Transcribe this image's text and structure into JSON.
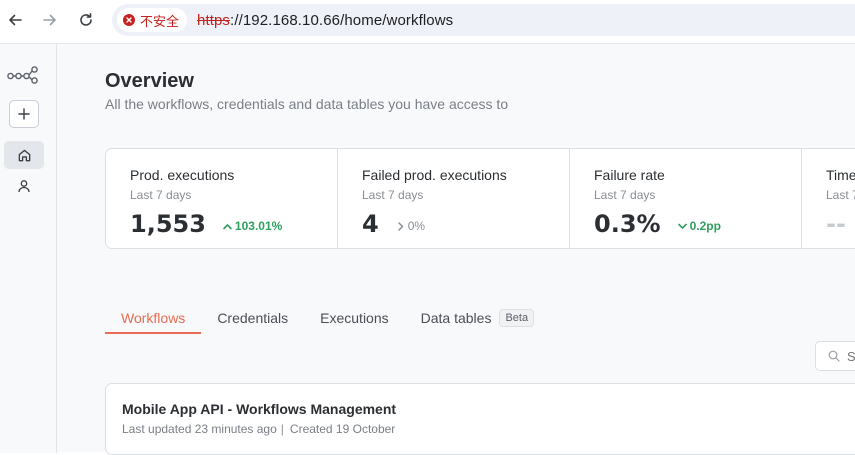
{
  "browser": {
    "security_label": "不安全",
    "url_scheme": "https",
    "url_rest": "://192.168.10.66/home/workflows"
  },
  "sidebar": {
    "icons": [
      "logo-icon",
      "plus-icon",
      "home-icon",
      "user-icon"
    ]
  },
  "overview": {
    "title": "Overview",
    "subtitle": "All the workflows, credentials and data tables you have access to"
  },
  "stats": [
    {
      "label": "Prod. executions",
      "period": "Last 7 days",
      "value": "1,553",
      "change": "103.01%",
      "trend": "up"
    },
    {
      "label": "Failed prod. executions",
      "period": "Last 7 days",
      "value": "4",
      "change": "0%",
      "trend": "flat"
    },
    {
      "label": "Failure rate",
      "period": "Last 7 days",
      "value": "0.3",
      "unit": "%",
      "change": "0.2pp",
      "trend": "down-good"
    },
    {
      "label": "Time",
      "period": "Last 7",
      "value": "--"
    }
  ],
  "tabs": [
    {
      "label": "Workflows",
      "active": true
    },
    {
      "label": "Credentials"
    },
    {
      "label": "Executions"
    },
    {
      "label": "Data tables",
      "badge": "Beta"
    }
  ],
  "search": {
    "placeholder": "S"
  },
  "workflows": [
    {
      "name": "Mobile App API - Workflows Management",
      "updated": "Last updated 23 minutes ago",
      "separator": "|",
      "created": "Created 19 October"
    }
  ],
  "colors": {
    "accent": "#ea6b52",
    "positive": "#2f9e5e",
    "danger": "#c5221f"
  }
}
